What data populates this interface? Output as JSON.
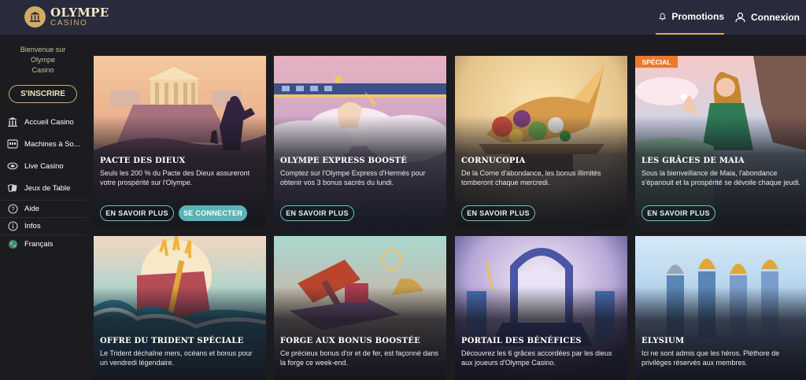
{
  "brand": {
    "name": "OLYMPE",
    "sub": "CASINO"
  },
  "nav": {
    "promotions": "Promotions",
    "login": "Connexion"
  },
  "sidebar": {
    "welcome": [
      "Bienvenue sur",
      "Olympe",
      "Casino"
    ],
    "signup": "S'INSCRIRE",
    "items": [
      {
        "label": "Accueil Casino",
        "icon": "temple-icon"
      },
      {
        "label": "Machines à So...",
        "icon": "slot-machine-icon"
      },
      {
        "label": "Live Casino",
        "icon": "live-icon"
      },
      {
        "label": "Jeux de Table",
        "icon": "table-games-icon"
      },
      {
        "label": "Aide",
        "icon": "help-icon"
      },
      {
        "label": "Infos",
        "icon": "info-icon"
      },
      {
        "label": "Français",
        "icon": "globe-icon"
      }
    ]
  },
  "cards": [
    {
      "title": "PACTE DES DIEUX",
      "desc": "Seuls les 200 % du Pacte des Dieux assureront votre prospérité sur l'Olympe.",
      "btn1": "EN SAVOIR PLUS",
      "btn2": "SE CONNECTER"
    },
    {
      "title": "OLYMPE EXPRESS BOOSTÉ",
      "desc": "Comptez sur l'Olympe Express d'Hermès pour obtenir vos 3 bonus sacrés du lundi.",
      "btn1": "EN SAVOIR PLUS"
    },
    {
      "title": "CORNUCOPIA",
      "desc": "De la Corne d'abondance, les bonus illimités tomberont chaque mercredi.",
      "btn1": "EN SAVOIR PLUS"
    },
    {
      "title": "LES GRÂCES DE MAIA",
      "desc": "Sous la bienveillance de Maia, l'abondance s'épanouit et la prospérité se dévoile chaque jeudi.",
      "btn1": "EN SAVOIR PLUS",
      "badge": "SPÉCIAL"
    },
    {
      "title": "OFFRE DU TRIDENT SPÉCIALE",
      "desc": "Le Trident déchaîne mers, océans et bonus pour un vendredi légendaire."
    },
    {
      "title": "FORGE AUX BONUS BOOSTÉE",
      "desc": "Ce précieux bonus d'or et de fer, est façonné dans la forge ce week-end."
    },
    {
      "title": "PORTAIL DES BÉNÉFICES",
      "desc": "Découvrez les 6 grâces accordées par les dieux aux joueurs d'Olympe Casino."
    },
    {
      "title": "ELYSIUM",
      "desc": "Ici ne sont admis que les héros. Pléthore de privilèges réservés aux membres."
    }
  ],
  "colors": {
    "header": "#282b3a",
    "sidebar": "#1b1c20",
    "gold": "#d3ab67",
    "teal": "#5ab3b6",
    "badge": "#e97a2f"
  }
}
